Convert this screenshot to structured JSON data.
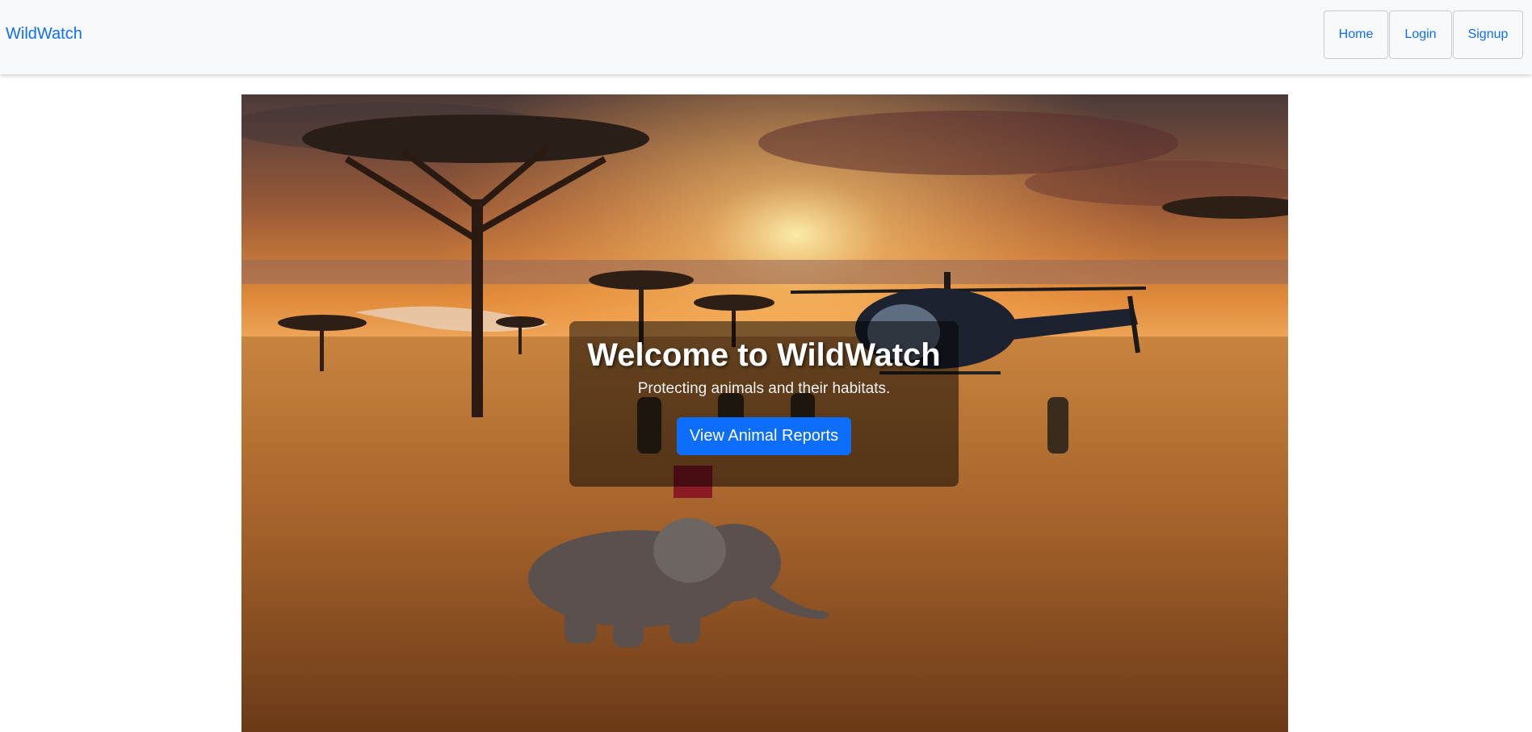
{
  "navbar": {
    "brand": "WildWatch",
    "links": [
      {
        "label": "Home"
      },
      {
        "label": "Login"
      },
      {
        "label": "Signup"
      }
    ]
  },
  "hero": {
    "title": "Welcome to WildWatch",
    "subtitle": "Protecting animals and their habitats.",
    "cta_label": "View Animal Reports"
  },
  "colors": {
    "primary": "#0d6efd",
    "navbar_bg": "#f8f9fa",
    "overlay": "rgba(0,0,0,0.5)"
  }
}
